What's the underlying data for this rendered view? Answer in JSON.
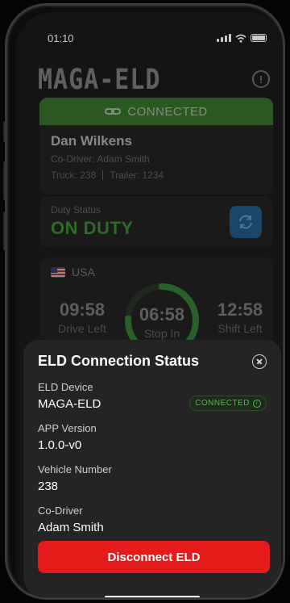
{
  "status_bar": {
    "time": "01:10"
  },
  "app": {
    "title": "MAGA-ELD"
  },
  "connection_bar": {
    "label": "CONNECTED"
  },
  "driver": {
    "name": "Dan Wilkens",
    "co_driver_label": "Co-Driver:",
    "co_driver_name": "Adam Smith",
    "truck": "Truck: 238",
    "trailer": "Trailer: 1234"
  },
  "duty": {
    "label": "Duty Status",
    "value": "ON DUTY"
  },
  "hos": {
    "country": "USA",
    "drive_left_time": "09:58",
    "drive_left_label": "Drive Left",
    "stop_in_time": "06:58",
    "stop_in_label": "Stop In",
    "shift_left_time": "12:58",
    "shift_left_label": "Shift Left"
  },
  "sheet": {
    "title": "ELD Connection Status",
    "device_label": "ELD Device",
    "device_value": "MAGA-ELD",
    "status_pill": "CONNECTED",
    "app_version_label": "APP Version",
    "app_version_value": "1.0.0-v0",
    "vehicle_label": "Vehicle Number",
    "vehicle_value": "238",
    "co_driver_label": "Co-Driver",
    "co_driver_value": "Adam Smith",
    "disconnect_label": "Disconnect ELD"
  },
  "colors": {
    "accent_green": "#43b33a",
    "danger_red": "#e31b1b",
    "sync_blue": "#1f6fb3"
  }
}
